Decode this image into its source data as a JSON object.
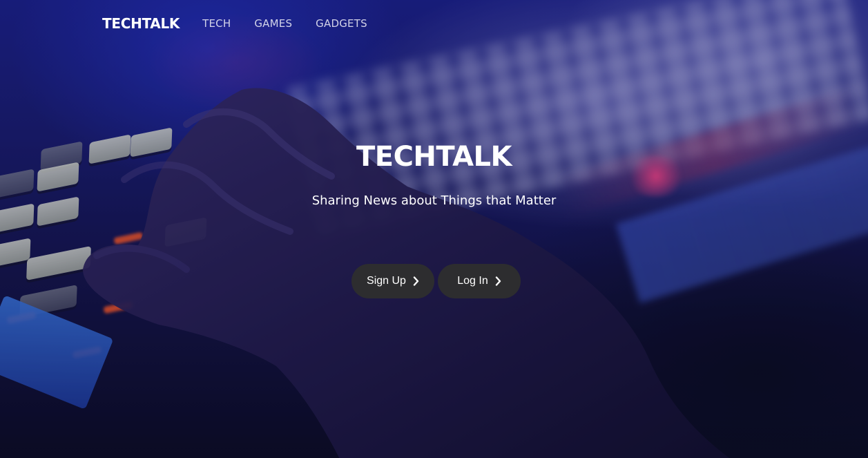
{
  "navbar": {
    "brand": "TECHTALK",
    "links": [
      {
        "label": "TECH"
      },
      {
        "label": "GAMES"
      },
      {
        "label": "GADGETS"
      }
    ]
  },
  "hero": {
    "title": "TECHTALK",
    "subtitle": "Sharing News about Things that Matter",
    "buttons": [
      {
        "label": "Sign Up",
        "icon": "chevron-right-icon"
      },
      {
        "label": "Log In",
        "icon": "chevron-right-icon"
      }
    ],
    "background_image": "hand-on-backlit-keyboard"
  },
  "colors": {
    "button_bg": "#2d2d2f",
    "text": "#ffffff",
    "background_tint": "#1a1d72"
  }
}
